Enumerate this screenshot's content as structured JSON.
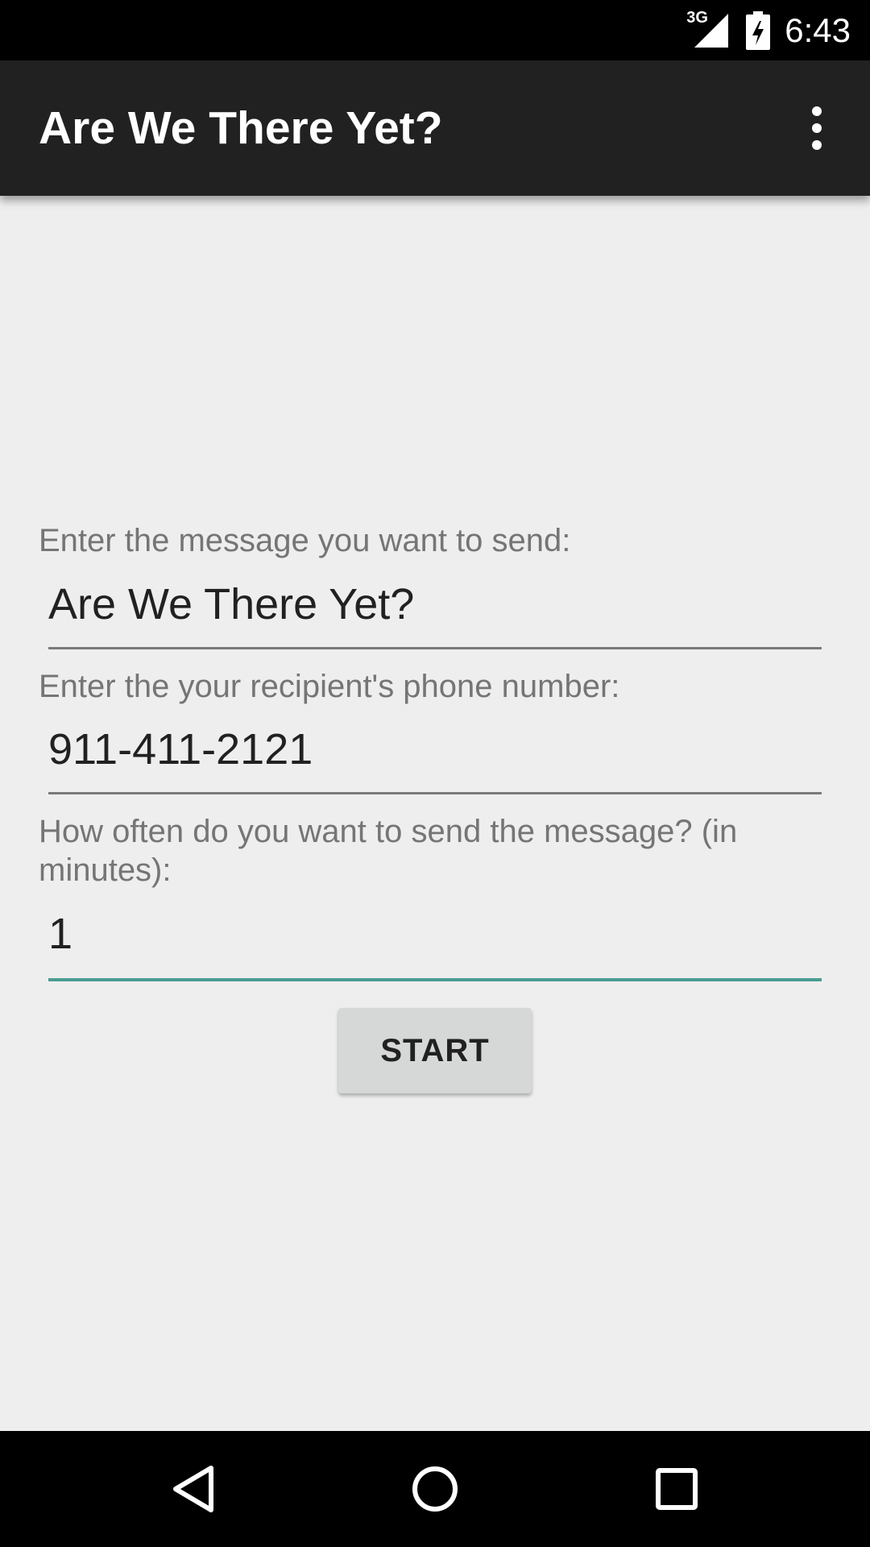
{
  "status_bar": {
    "network_type": "3G",
    "time": "6:43",
    "icons": [
      "signal-icon",
      "battery-charging-icon"
    ]
  },
  "app_bar": {
    "title": "Are We There Yet?",
    "overflow_icon": "more-vert-icon"
  },
  "form": {
    "message": {
      "label": "Enter the message you want to send:",
      "value": "Are We There Yet?"
    },
    "phone": {
      "label": "Enter the your recipient's phone number:",
      "value": "911-411-2121"
    },
    "interval": {
      "label": "How often do you want to send the message? (in minutes):",
      "value": "1"
    },
    "start_button_label": "START"
  },
  "nav_bar": {
    "icons": [
      "back-icon",
      "home-icon",
      "recents-icon"
    ]
  },
  "colors": {
    "app_bar": "#212121",
    "status_bar": "#000000",
    "background": "#eeeeee",
    "accent": "#4a9c92"
  }
}
